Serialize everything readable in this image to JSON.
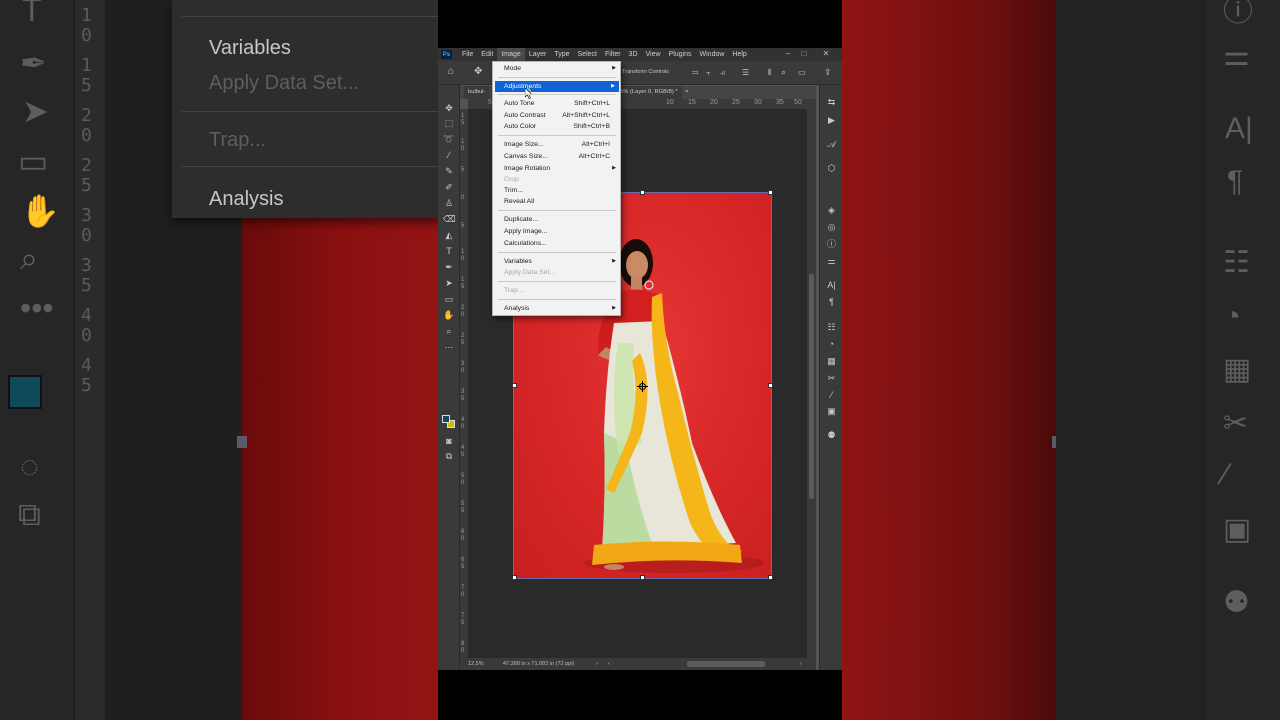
{
  "app": {
    "logo_text": "Ps"
  },
  "menubar": {
    "items": [
      "File",
      "Edit",
      "Image",
      "Layer",
      "Type",
      "Select",
      "Filter",
      "3D",
      "View",
      "Plugins",
      "Window",
      "Help"
    ],
    "active": "Image"
  },
  "options_bar": {
    "transform_controls": "Transform Controls"
  },
  "document_tabs": {
    "tab1": "bulbul-",
    "tab2": "5% (Layer 0, RGB/8) *"
  },
  "ruler": {
    "horizontal": [
      "5",
      "10",
      "15",
      "20",
      "25",
      "30",
      "35",
      "40",
      "45",
      "50"
    ],
    "vertical": [
      "1 5",
      "1 0",
      "5",
      "0",
      "5",
      "1 0",
      "1 5",
      "2 0",
      "2 5",
      "3 0",
      "3 5",
      "4 0",
      "4 5",
      "5 0",
      "5 5",
      "6 0",
      "6 5",
      "7 0",
      "7 5",
      "8 0"
    ]
  },
  "status_bar": {
    "zoom": "12.5%",
    "doc_info": "47.389 in x 71.083 in (72 ppi)"
  },
  "image_menu": {
    "mode": "Mode",
    "adjustments": "Adjustments",
    "auto_tone": "Auto Tone",
    "auto_tone_shortcut": "Shift+Ctrl+L",
    "auto_contrast": "Auto Contrast",
    "auto_contrast_shortcut": "Alt+Shift+Ctrl+L",
    "auto_color": "Auto Color",
    "auto_color_shortcut": "Shift+Ctrl+B",
    "image_size": "Image Size...",
    "image_size_shortcut": "Alt+Ctrl+I",
    "canvas_size": "Canvas Size...",
    "canvas_size_shortcut": "Alt+Ctrl+C",
    "image_rotation": "Image Rotation",
    "crop": "Crop",
    "trim": "Trim...",
    "reveal_all": "Reveal All",
    "duplicate": "Duplicate...",
    "apply_image": "Apply Image...",
    "calculations": "Calculations...",
    "variables": "Variables",
    "apply_data_set": "Apply Data Set...",
    "trap": "Trap...",
    "analysis": "Analysis"
  },
  "background_zoom": {
    "variables": "Variables",
    "apply_data_set": "Apply Data Set...",
    "trap": "Trap...",
    "analysis": "Analysis",
    "ruler_digits": [
      "1 0",
      "1 5",
      "2 0",
      "2 5",
      "3 0",
      "3 5",
      "4 0",
      "4 5"
    ]
  },
  "colors": {
    "highlight": "#0e63d6",
    "backdrop_red": "#d92828",
    "foreground_swatch": "#0f4a5a",
    "background_swatch": "#d8b800"
  },
  "icons": [
    "home-icon",
    "move-icon",
    "marquee-icon",
    "lasso-icon",
    "brush-icon",
    "eyedropper-icon",
    "stamp-icon",
    "eraser-icon",
    "type-icon",
    "pen-icon",
    "hand-icon",
    "zoom-icon",
    "more-icon",
    "layers-icon",
    "adjustments-icon",
    "properties-icon",
    "character-icon",
    "paragraph-icon",
    "search-icon",
    "share-icon"
  ]
}
